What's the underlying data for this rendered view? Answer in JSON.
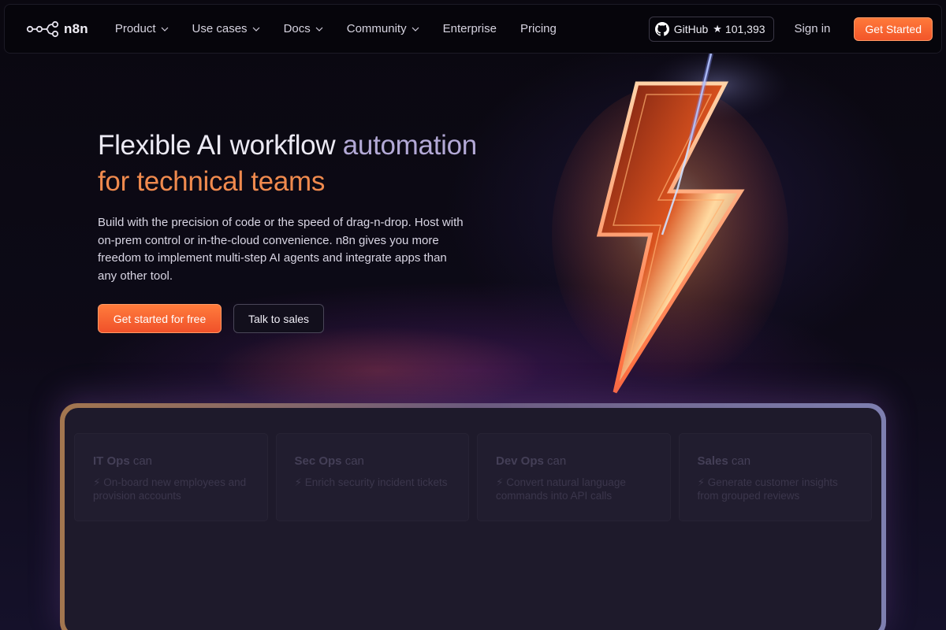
{
  "brand": {
    "name": "n8n",
    "logo_icon": "n8n-nodes-logo"
  },
  "nav": {
    "items": [
      {
        "label": "Product",
        "dropdown": true
      },
      {
        "label": "Use cases",
        "dropdown": true
      },
      {
        "label": "Docs",
        "dropdown": true
      },
      {
        "label": "Community",
        "dropdown": true
      },
      {
        "label": "Enterprise",
        "dropdown": false
      },
      {
        "label": "Pricing",
        "dropdown": false
      }
    ],
    "github": {
      "label": "GitHub",
      "star": "★",
      "count": "101,393",
      "icon": "github-icon"
    },
    "signin_label": "Sign in",
    "get_started_label": "Get Started"
  },
  "hero": {
    "title_part1": "Flexible AI workflow ",
    "title_part2": "automation",
    "title_line2": "for technical teams",
    "description": "Build with the precision of code or the speed of drag-n-drop. Host with on-prem control or in-the-cloud convenience. n8n gives you more freedom to implement multi-step AI agents and integrate apps than any other tool.",
    "cta_primary": "Get started for free",
    "cta_secondary": "Talk to sales"
  },
  "use_cases": [
    {
      "team": "IT Ops",
      "suffix": " can",
      "text": "⚡ On-board new employees and provision accounts"
    },
    {
      "team": "Sec Ops",
      "suffix": " can",
      "text": "⚡ Enrich security incident tickets"
    },
    {
      "team": "Dev Ops",
      "suffix": " can",
      "text": "⚡ Convert natural language commands into API calls"
    },
    {
      "team": "Sales",
      "suffix": " can",
      "text": "⚡ Generate customer insights from grouped reviews"
    }
  ],
  "colors": {
    "accent_orange": "#f2552a",
    "title_highlight": "#f08a4e",
    "title_muted": "#b3a9d6",
    "background": "#0e0b18"
  }
}
